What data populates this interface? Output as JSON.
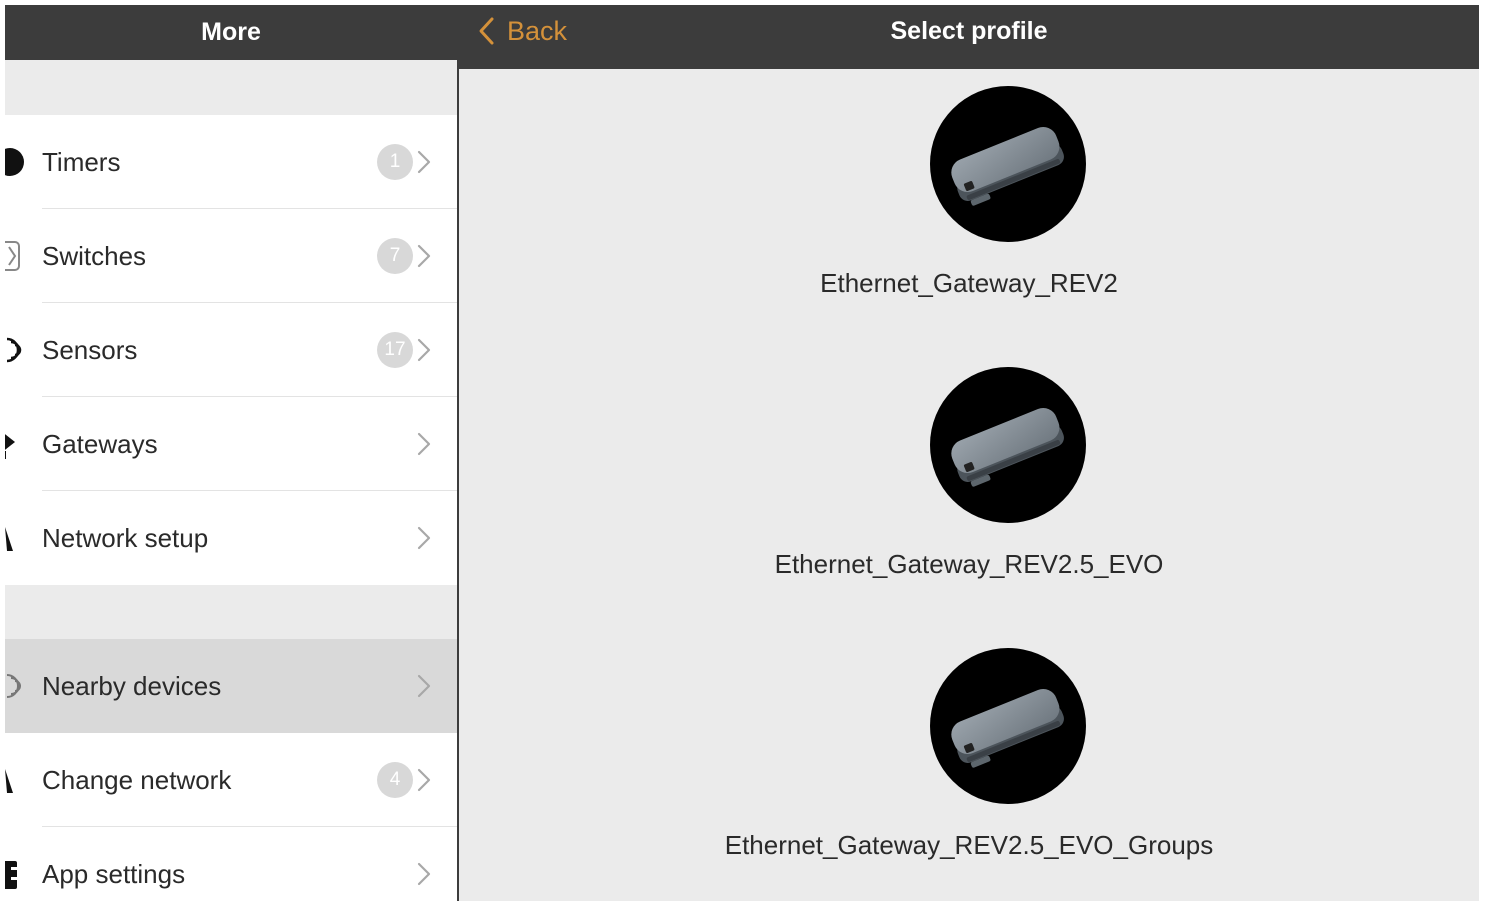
{
  "left_panel": {
    "title": "More",
    "items": [
      {
        "label": "Timers",
        "badge": "1",
        "icon": "timer-icon"
      },
      {
        "label": "Switches",
        "badge": "7",
        "icon": "switch-icon"
      },
      {
        "label": "Sensors",
        "badge": "17",
        "icon": "sensor-icon"
      },
      {
        "label": "Gateways",
        "badge": "",
        "icon": "gateway-icon"
      },
      {
        "label": "Network setup",
        "badge": "",
        "icon": "network-icon"
      },
      {
        "label": "Nearby devices",
        "badge": "",
        "icon": "nearby-icon",
        "selected": true
      },
      {
        "label": "Change network",
        "badge": "4",
        "icon": "network-icon"
      },
      {
        "label": "App settings",
        "badge": "",
        "icon": "settings-icon"
      }
    ]
  },
  "right_panel": {
    "back_label": "Back",
    "title": "Select profile",
    "profiles": [
      {
        "name": "Ethernet_Gateway_REV2",
        "icon": "gateway-device-icon"
      },
      {
        "name": "Ethernet_Gateway_REV2.5_EVO",
        "icon": "gateway-device-icon"
      },
      {
        "name": "Ethernet_Gateway_REV2.5_EVO_Groups",
        "icon": "gateway-device-icon"
      }
    ]
  },
  "colors": {
    "header_bg": "#3c3c3c",
    "accent": "#d4913a",
    "panel_bg": "#ebebeb",
    "selected_row": "#d9d9d9",
    "badge_bg": "#d8d8d8"
  }
}
